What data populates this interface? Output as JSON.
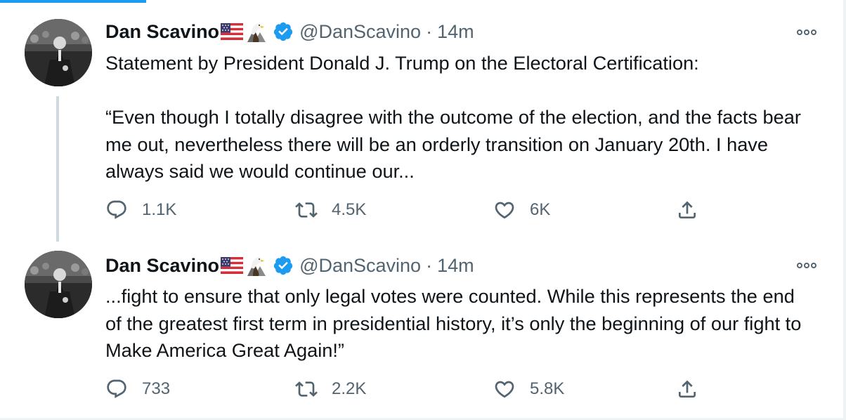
{
  "colors": {
    "accent": "#1d9bf0",
    "text": "#0f1419",
    "muted": "#536471",
    "thread_line": "#cfd9de"
  },
  "tweets": [
    {
      "author_name": "Dan Scavino",
      "author_emoji": [
        "flag-us-icon",
        "eagle-icon"
      ],
      "verified": true,
      "handle": "@DanScavino",
      "separator": "·",
      "time": "14m",
      "paragraphs": [
        "Statement by President Donald J. Trump on the Electoral Certification:",
        "“Even though I totally disagree with the outcome of the election, and the facts bear me out, nevertheless there will be an orderly transition on January 20th. I have always said we would continue our..."
      ],
      "replies": "1.1K",
      "retweets": "4.5K",
      "likes": "6K"
    },
    {
      "author_name": "Dan Scavino",
      "author_emoji": [
        "flag-us-icon",
        "eagle-icon"
      ],
      "verified": true,
      "handle": "@DanScavino",
      "separator": "·",
      "time": "14m",
      "paragraphs": [
        "...fight to ensure that only legal votes were counted. While this represents the end of the greatest first term in presidential history, it’s only the beginning of our fight to Make America Great Again!”"
      ],
      "replies": "733",
      "retweets": "2.2K",
      "likes": "5.8K"
    }
  ]
}
